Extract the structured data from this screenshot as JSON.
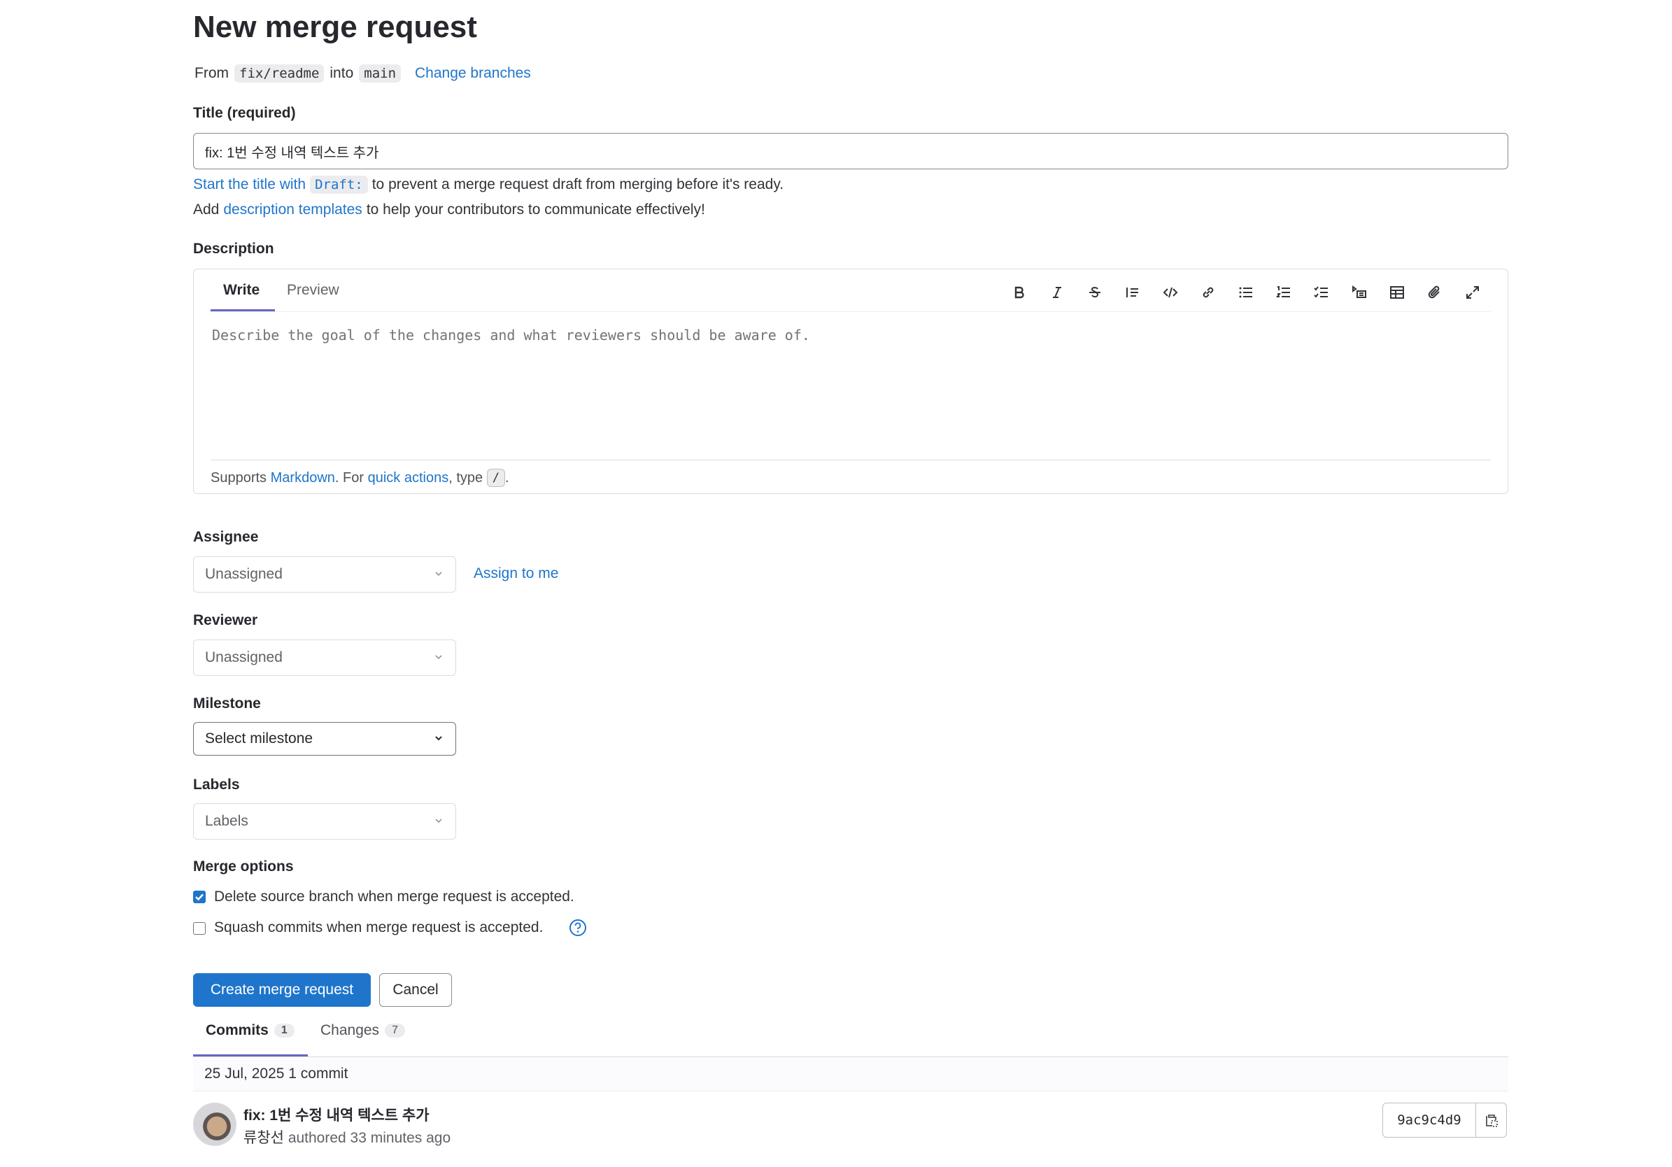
{
  "page": {
    "title": "New merge request",
    "from_label": "From",
    "source_branch": "fix/readme",
    "into_label": "into",
    "target_branch": "main",
    "change_branches": "Change branches"
  },
  "title_field": {
    "label": "Title (required)",
    "value": "fix: 1번 수정 내역 텍스트 추가",
    "hint_link": "Start the title with",
    "hint_code": "Draft:",
    "hint_rest": "to prevent a merge request draft from merging before it's ready.",
    "templates_prefix": "Add",
    "templates_link": "description templates",
    "templates_rest": "to help your contributors to communicate effectively!"
  },
  "description": {
    "label": "Description",
    "tabs": [
      "Write",
      "Preview"
    ],
    "placeholder": "Describe the goal of the changes and what reviewers should be aware of.",
    "footer_prefix": "Supports",
    "footer_markdown": "Markdown",
    "footer_mid": ". For",
    "footer_quick": "quick actions",
    "footer_type": ", type",
    "footer_code": "/",
    "footer_end": ".",
    "toolbar_icons": [
      "bold-icon",
      "italic-icon",
      "strikethrough-icon",
      "quote-icon",
      "code-icon",
      "link-icon",
      "bullet-list-icon",
      "numbered-list-icon",
      "task-list-icon",
      "collapsible-icon",
      "table-icon",
      "attachment-icon",
      "fullscreen-icon"
    ]
  },
  "assignee": {
    "label": "Assignee",
    "value": "Unassigned",
    "assign_me": "Assign to me"
  },
  "reviewer": {
    "label": "Reviewer",
    "value": "Unassigned"
  },
  "milestone": {
    "label": "Milestone",
    "value": "Select milestone"
  },
  "labels": {
    "label": "Labels",
    "value": "Labels"
  },
  "merge_options": {
    "label": "Merge options",
    "delete_branch": {
      "text": "Delete source branch when merge request is accepted.",
      "checked": true
    },
    "squash": {
      "text": "Squash commits when merge request is accepted.",
      "checked": false
    }
  },
  "actions": {
    "create": "Create merge request",
    "cancel": "Cancel"
  },
  "bottom_tabs": [
    {
      "label": "Commits",
      "count": "1"
    },
    {
      "label": "Changes",
      "count": "7"
    }
  ],
  "commits": {
    "group_header": "25 Jul, 2025 1 commit",
    "items": [
      {
        "title": "fix: 1번 수정 내역 텍스트 추가",
        "author": "류창선",
        "meta": "authored 33 minutes ago",
        "sha": "9ac9c4d9"
      }
    ]
  },
  "colors": {
    "link": "#1f75cb",
    "primary": "#1f75cb",
    "tab_underline": "#6666c4"
  }
}
